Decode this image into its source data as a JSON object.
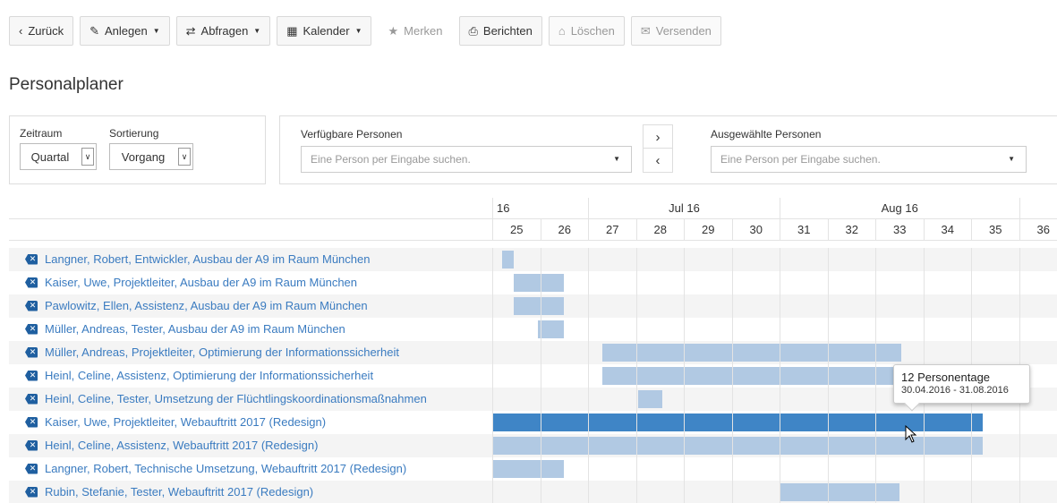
{
  "toolbar": {
    "back": "Zurück",
    "create": "Anlegen",
    "queries": "Abfragen",
    "calendar": "Kalender",
    "bookmark": "Merken",
    "reports": "Berichten",
    "delete": "Löschen",
    "send": "Versenden"
  },
  "page_title": "Personalplaner",
  "filters": {
    "period_label": "Zeitraum",
    "period_value": "Quartal",
    "sort_label": "Sortierung",
    "sort_value": "Vorgang",
    "available_label": "Verfügbare Personen",
    "available_placeholder": "Eine Person per Eingabe suchen.",
    "selected_label": "Ausgewählte Personen",
    "selected_placeholder": "Eine Person per Eingabe suchen."
  },
  "timeline": {
    "months": [
      "16",
      "Jul 16",
      "Aug 16"
    ],
    "weeks": [
      "25",
      "26",
      "27",
      "28",
      "29",
      "30",
      "31",
      "32",
      "33",
      "34",
      "35",
      "36"
    ]
  },
  "rows": [
    {
      "label": "Langner, Robert, Entwickler, Ausbau der A9 im Raum München",
      "start": 25.2,
      "end": 25.45
    },
    {
      "label": "Kaiser, Uwe, Projektleiter, Ausbau der A9 im Raum München",
      "start": 25.45,
      "end": 26.5
    },
    {
      "label": "Pawlowitz, Ellen, Assistenz, Ausbau der A9 im Raum München",
      "start": 25.45,
      "end": 26.5
    },
    {
      "label": "Müller, Andreas, Tester, Ausbau der A9 im Raum München",
      "start": 25.95,
      "end": 26.5
    },
    {
      "label": "Müller, Andreas, Projektleiter, Optimierung der Informationssicherheit",
      "start": 27.3,
      "end": 33.55
    },
    {
      "label": "Heinl, Celine, Assistenz, Optimierung der Informationssicherheit",
      "start": 27.3,
      "end": 33.55
    },
    {
      "label": "Heinl, Celine, Tester, Umsetzung der Flüchtlingskoordinationsmaßnahmen",
      "start": 28.05,
      "end": 28.55
    },
    {
      "label": "Kaiser, Uwe, Projektleiter, Webauftritt 2017 (Redesign)",
      "start": 25.0,
      "end": 35.25,
      "active": true
    },
    {
      "label": "Heinl, Celine, Assistenz, Webauftritt 2017 (Redesign)",
      "start": 25.0,
      "end": 35.25
    },
    {
      "label": "Langner, Robert, Technische Umsetzung, Webauftritt 2017 (Redesign)",
      "start": 25.0,
      "end": 26.5
    },
    {
      "label": "Rubin, Stefanie, Tester, Webauftritt 2017 (Redesign)",
      "start": 31.0,
      "end": 33.5
    }
  ],
  "tooltip": {
    "title": "12 Personentage",
    "dates": "30.04.2016 - 31.08.2016"
  },
  "colors": {
    "bar": "#b1c9e3",
    "bar_active": "#3f85c6",
    "link": "#3a7bc0"
  }
}
